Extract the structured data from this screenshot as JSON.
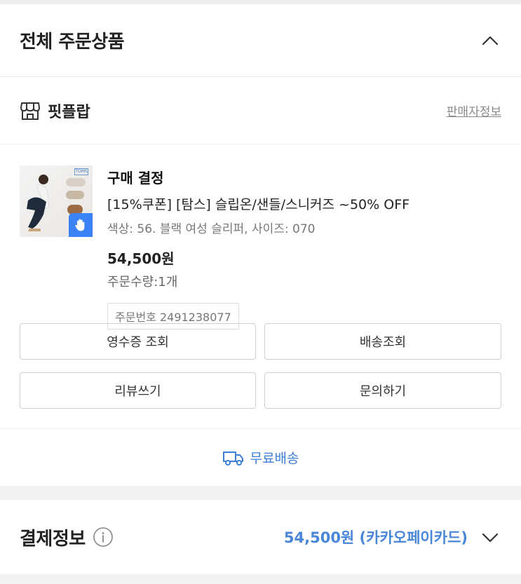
{
  "order_section": {
    "title": "전체 주문상품",
    "store": {
      "name": "핏플랍",
      "seller_info_link": "판매자정보"
    },
    "product": {
      "status": "구매 결정",
      "name": "[15%쿠폰] [탐스] 슬립온/샌들/스니커즈 ~50% OFF",
      "option": "색상: 56. 블랙 여성 슬리퍼, 사이즈: 070",
      "price": "54,500원",
      "quantity": "주문수량:1개",
      "order_number": "주문번호 2491238077",
      "thumb_brand": "TOMS"
    },
    "buttons": {
      "receipt": "영수증 조회",
      "tracking": "배송조회",
      "review": "리뷰쓰기",
      "inquiry": "문의하기"
    },
    "shipping": {
      "label": "무료배송",
      "icon": "truck-icon"
    }
  },
  "payment_section": {
    "title": "결제정보",
    "amount": "54,500원 (카카오페이카드)",
    "icon": "info-icon"
  },
  "colors": {
    "accent": "#3d7fd8",
    "pay_amount": "#4a86d8",
    "badge": "#3b82f6"
  }
}
